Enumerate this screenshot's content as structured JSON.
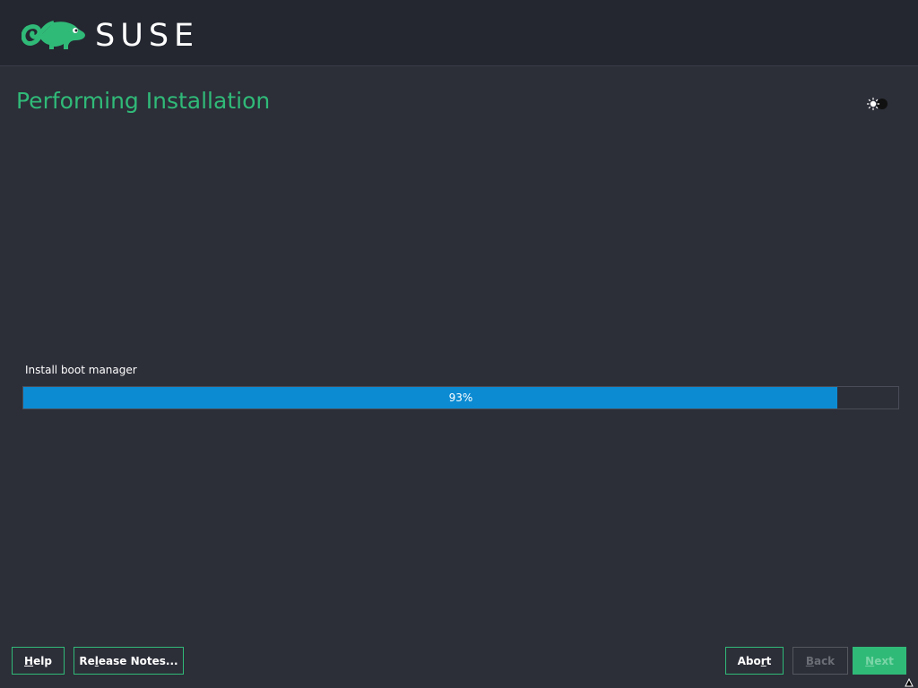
{
  "header": {
    "logo_text": "SUSE",
    "logo_icon": "chameleon-icon",
    "background_color": "#242730"
  },
  "main": {
    "title": "Performing Installation",
    "title_color": "#30ba78",
    "theme_toggle_icon": "theme-toggle-icon"
  },
  "progress": {
    "label": "Install boot manager",
    "percent": 93,
    "percent_text": "93%",
    "fill_color": "#0c8bd3"
  },
  "buttons": {
    "help": {
      "prefix": "",
      "accel": "H",
      "suffix": "elp"
    },
    "release_notes": {
      "prefix": "Re",
      "accel": "l",
      "suffix": "ease Notes..."
    },
    "abort": {
      "prefix": "Abo",
      "accel": "r",
      "suffix": "t"
    },
    "back": {
      "prefix": "",
      "accel": "B",
      "suffix": "ack",
      "enabled": false
    },
    "next": {
      "prefix": "",
      "accel": "N",
      "suffix": "ext",
      "enabled": false
    }
  },
  "accent_color": "#30ba78"
}
